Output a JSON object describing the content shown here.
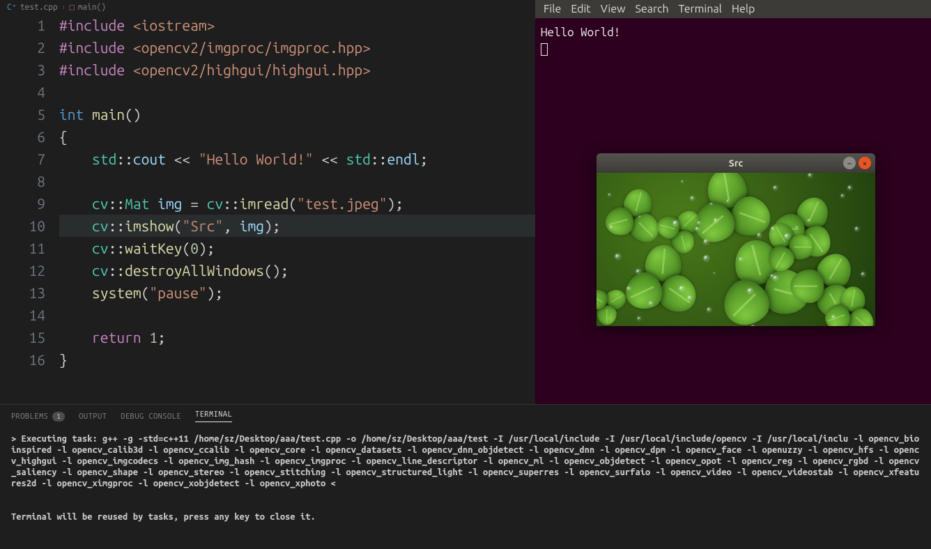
{
  "breadcrumb": {
    "file": "test.cpp",
    "symbol": "main()"
  },
  "editor": {
    "lines": [
      {
        "n": 1,
        "tokens": [
          {
            "t": "#include ",
            "c": "kw-include"
          },
          {
            "t": "<iostream>",
            "c": "path"
          }
        ]
      },
      {
        "n": 2,
        "tokens": [
          {
            "t": "#include ",
            "c": "kw-include"
          },
          {
            "t": "<opencv2/imgproc/imgproc.hpp>",
            "c": "path"
          }
        ]
      },
      {
        "n": 3,
        "tokens": [
          {
            "t": "#include ",
            "c": "kw-include"
          },
          {
            "t": "<opencv2/highgui/highgui.hpp>",
            "c": "path"
          }
        ]
      },
      {
        "n": 4,
        "tokens": []
      },
      {
        "n": 5,
        "tokens": [
          {
            "t": "int ",
            "c": "kw-int"
          },
          {
            "t": "main",
            "c": "fn"
          },
          {
            "t": "()",
            "c": "punct"
          }
        ]
      },
      {
        "n": 6,
        "tokens": [
          {
            "t": "{",
            "c": "punct"
          }
        ]
      },
      {
        "n": 7,
        "tokens": [
          {
            "t": "    ",
            "c": ""
          },
          {
            "t": "std",
            "c": "ns"
          },
          {
            "t": "::",
            "c": "punct"
          },
          {
            "t": "cout",
            "c": "var"
          },
          {
            "t": " << ",
            "c": "punct"
          },
          {
            "t": "\"Hello World!\"",
            "c": "str"
          },
          {
            "t": " << ",
            "c": "punct"
          },
          {
            "t": "std",
            "c": "ns"
          },
          {
            "t": "::",
            "c": "punct"
          },
          {
            "t": "endl",
            "c": "var"
          },
          {
            "t": ";",
            "c": "punct"
          }
        ]
      },
      {
        "n": 8,
        "tokens": []
      },
      {
        "n": 9,
        "tokens": [
          {
            "t": "    ",
            "c": ""
          },
          {
            "t": "cv",
            "c": "ns"
          },
          {
            "t": "::",
            "c": "punct"
          },
          {
            "t": "Mat ",
            "c": "type"
          },
          {
            "t": "img",
            "c": "var"
          },
          {
            "t": " = ",
            "c": "punct"
          },
          {
            "t": "cv",
            "c": "ns"
          },
          {
            "t": "::",
            "c": "punct"
          },
          {
            "t": "imread",
            "c": "fn"
          },
          {
            "t": "(",
            "c": "punct"
          },
          {
            "t": "\"test.jpeg\"",
            "c": "str"
          },
          {
            "t": ");",
            "c": "punct"
          }
        ]
      },
      {
        "n": 10,
        "hl": true,
        "tokens": [
          {
            "t": "    ",
            "c": ""
          },
          {
            "t": "cv",
            "c": "ns"
          },
          {
            "t": "::",
            "c": "punct"
          },
          {
            "t": "imshow",
            "c": "fn"
          },
          {
            "t": "(",
            "c": "punct"
          },
          {
            "t": "\"Src\"",
            "c": "str"
          },
          {
            "t": ", ",
            "c": "punct"
          },
          {
            "t": "img",
            "c": "var"
          },
          {
            "t": ");",
            "c": "punct"
          }
        ]
      },
      {
        "n": 11,
        "tokens": [
          {
            "t": "    ",
            "c": ""
          },
          {
            "t": "cv",
            "c": "ns"
          },
          {
            "t": "::",
            "c": "punct"
          },
          {
            "t": "waitKey",
            "c": "fn"
          },
          {
            "t": "(",
            "c": "punct"
          },
          {
            "t": "0",
            "c": "num"
          },
          {
            "t": ");",
            "c": "punct"
          }
        ]
      },
      {
        "n": 12,
        "tokens": [
          {
            "t": "    ",
            "c": ""
          },
          {
            "t": "cv",
            "c": "ns"
          },
          {
            "t": "::",
            "c": "punct"
          },
          {
            "t": "destroyAllWindows",
            "c": "fn"
          },
          {
            "t": "();",
            "c": "punct"
          }
        ]
      },
      {
        "n": 13,
        "tokens": [
          {
            "t": "    ",
            "c": ""
          },
          {
            "t": "system",
            "c": "fn"
          },
          {
            "t": "(",
            "c": "punct"
          },
          {
            "t": "\"pause\"",
            "c": "str"
          },
          {
            "t": ");",
            "c": "punct"
          }
        ]
      },
      {
        "n": 14,
        "tokens": []
      },
      {
        "n": 15,
        "tokens": [
          {
            "t": "    ",
            "c": ""
          },
          {
            "t": "return ",
            "c": "kw-return"
          },
          {
            "t": "1",
            "c": "num"
          },
          {
            "t": ";",
            "c": "punct"
          }
        ]
      },
      {
        "n": 16,
        "tokens": [
          {
            "t": "}",
            "c": "punct"
          }
        ]
      }
    ]
  },
  "panel": {
    "tabs": {
      "problems": "PROBLEMS",
      "problems_badge": "1",
      "output": "OUTPUT",
      "debug": "DEBUG CONSOLE",
      "terminal": "TERMINAL"
    },
    "output_text": "> Executing task: g++ -g -std=c++11 /home/sz/Desktop/aaa/test.cpp -o /home/sz/Desktop/aaa/test -I /usr/local/include -I /usr/local/include/opencv -I /usr/local/inclu -l opencv_bioinspired -l opencv_calib3d -l opencv_ccalib -l opencv_core -l opencv_datasets -l opencv_dnn_objdetect -l opencv_dnn -l opencv_dpm -l opencv_face -l openuzzy -l opencv_hfs -l opencv_highgui -l opencv_imgcodecs -l opencv_img_hash -l opencv_imgproc -l opencv_line_descriptor -l opencv_ml -l opencv_objdetect -l opencv_opot -l opencv_reg -l opencv_rgbd -l opencv_saliency -l opencv_shape -l opencv_stereo -l opencv_stitching -l opencv_structured_light -l opencv_superres -l opencv_surfaio -l opencv_video -l opencv_videostab -l opencv_xfeatures2d -l opencv_ximgproc -l opencv_xobjdetect -l opencv_xphoto <\n\n\nTerminal will be reused by tasks, press any key to close it."
  },
  "terminal": {
    "menu": [
      "File",
      "Edit",
      "View",
      "Search",
      "Terminal",
      "Help"
    ],
    "line1": "Hello World!"
  },
  "cv_window": {
    "title": "Src"
  }
}
